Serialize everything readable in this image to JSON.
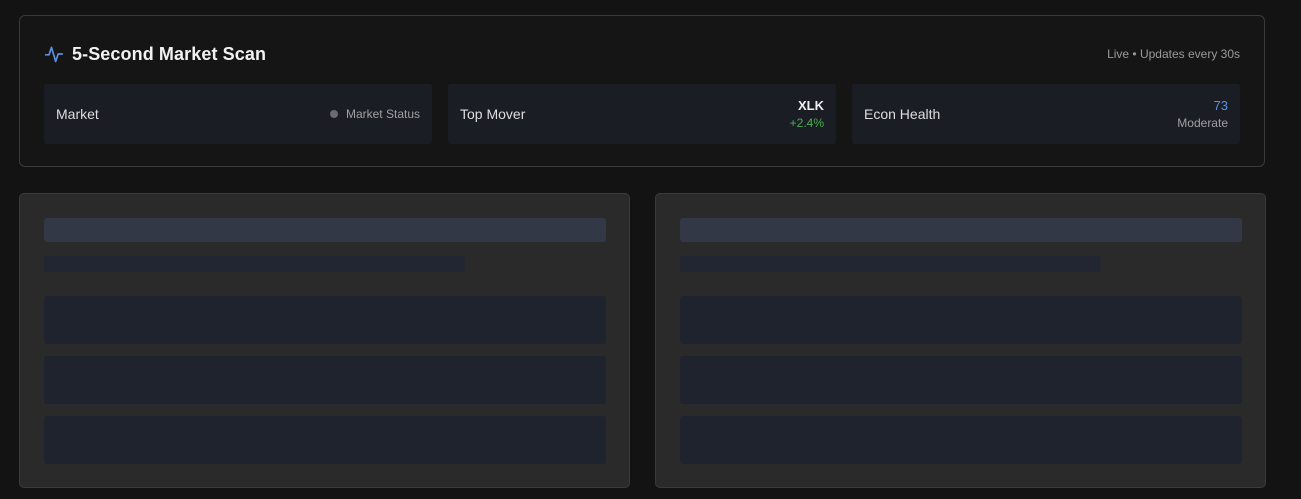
{
  "scan": {
    "title": "5-Second Market Scan",
    "live_text": "Live • Updates every 30s",
    "icon": "activity-pulse-icon",
    "accent_color": "#5b8fe0"
  },
  "metrics": {
    "market": {
      "label": "Market",
      "status_text": "Market Status",
      "status_color": "#6b6b70"
    },
    "top_mover": {
      "label": "Top Mover",
      "ticker": "XLK",
      "change": "+2.4%",
      "change_color": "#4caf50"
    },
    "econ_health": {
      "label": "Econ Health",
      "score": "73",
      "grade": "Moderate"
    }
  },
  "panels": [
    {
      "state": "loading-skeleton",
      "rows": 3
    },
    {
      "state": "loading-skeleton",
      "rows": 3
    }
  ]
}
